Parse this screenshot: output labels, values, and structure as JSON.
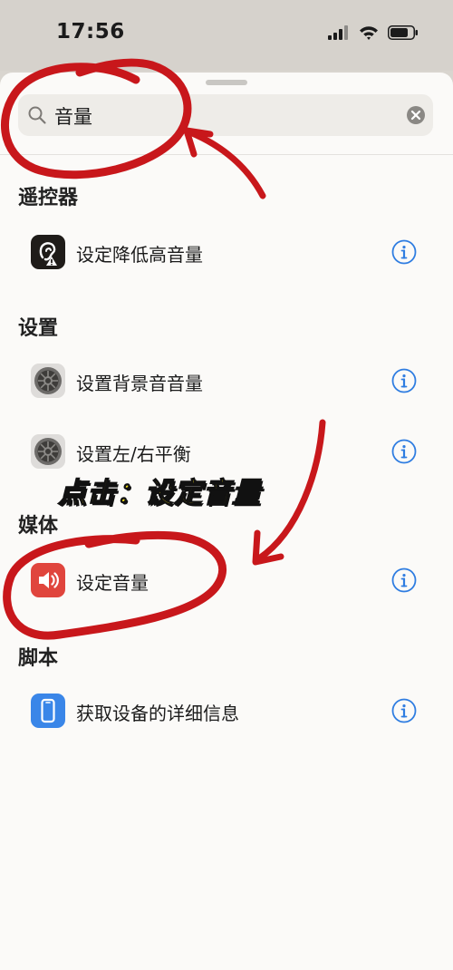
{
  "status_bar": {
    "time": "17:56",
    "icons": [
      "cellular-signal-icon",
      "wifi-icon",
      "battery-icon"
    ]
  },
  "search": {
    "query": "音量",
    "icons": [
      "search-icon",
      "clear-icon"
    ]
  },
  "sections": [
    {
      "title": "遥控器",
      "items": [
        {
          "label": "设定降低高音量",
          "icon": "ear-hearing-icon"
        }
      ]
    },
    {
      "title": "设置",
      "items": [
        {
          "label": "设置背景音音量",
          "icon": "settings-gear-icon"
        },
        {
          "label": "设置左/右平衡",
          "icon": "settings-gear-icon"
        }
      ]
    },
    {
      "title": "媒体",
      "items": [
        {
          "label": "设定音量",
          "icon": "speaker-volume-icon"
        }
      ]
    },
    {
      "title": "脚本",
      "items": [
        {
          "label": "获取设备的详细信息",
          "icon": "phone-device-icon"
        }
      ]
    }
  ],
  "overlay_caption": "点击：设定音量",
  "colors": {
    "accent_blue": "#2f7de1",
    "annotation_red": "#c8171b",
    "caption_yellow": "#f5e21a",
    "media_icon_red": "#e0453d",
    "script_icon_blue": "#3a86e8"
  }
}
